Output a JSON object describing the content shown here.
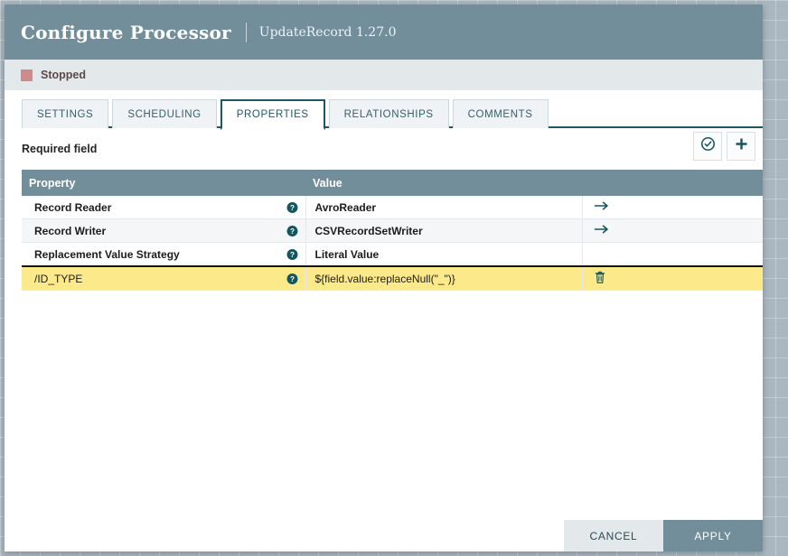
{
  "header": {
    "title": "Configure Processor",
    "subtitle": "UpdateRecord 1.27.0"
  },
  "status": {
    "label": "Stopped",
    "color": "#cf8a8a"
  },
  "tabs": [
    {
      "label": "SETTINGS",
      "active": false
    },
    {
      "label": "SCHEDULING",
      "active": false
    },
    {
      "label": "PROPERTIES",
      "active": true
    },
    {
      "label": "RELATIONSHIPS",
      "active": false
    },
    {
      "label": "COMMENTS",
      "active": false
    }
  ],
  "toolbar": {
    "required_field_label": "Required field",
    "verify_icon": "check-circle-icon",
    "add_icon": "plus-icon"
  },
  "table": {
    "columns": [
      "Property",
      "Value",
      ""
    ],
    "rows": [
      {
        "property": "Record Reader",
        "value": "AvroReader",
        "help_icon": "help-icon",
        "action_icon": "go-to-arrow-icon",
        "highlight": false
      },
      {
        "property": "Record Writer",
        "value": "CSVRecordSetWriter",
        "help_icon": "help-icon",
        "action_icon": "go-to-arrow-icon",
        "highlight": false
      },
      {
        "property": "Replacement Value Strategy",
        "value": "Literal Value",
        "help_icon": "help-icon",
        "action_icon": "",
        "highlight": false
      },
      {
        "property": "/ID_TYPE",
        "value": "${field.value:replaceNull(\"_\")}",
        "help_icon": "help-icon",
        "action_icon": "trash-icon",
        "highlight": true
      }
    ]
  },
  "footer": {
    "cancel_label": "CANCEL",
    "apply_label": "APPLY"
  },
  "colors": {
    "header_bg": "#728e9b",
    "accent": "#1b5767",
    "highlight_row": "#fbe98a",
    "icon_teal": "#14565f"
  }
}
